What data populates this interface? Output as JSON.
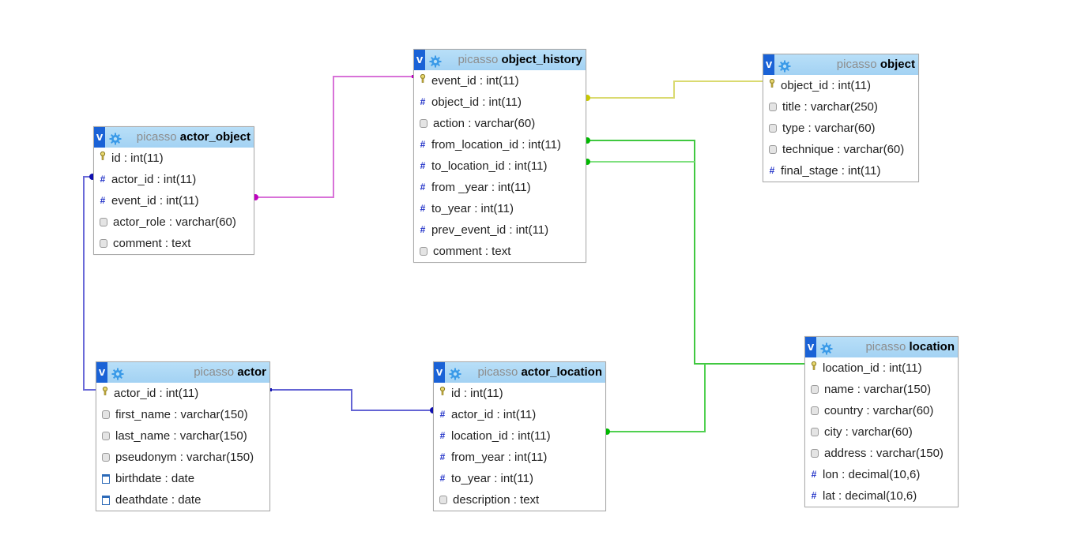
{
  "tables": {
    "actor_object": {
      "db": "picasso",
      "name": "actor_object",
      "columns": [
        {
          "icon": "key",
          "label": "id : int(11)"
        },
        {
          "icon": "num",
          "label": "actor_id : int(11)"
        },
        {
          "icon": "num",
          "label": "event_id : int(11)"
        },
        {
          "icon": "txt",
          "label": "actor_role : varchar(60)"
        },
        {
          "icon": "txt",
          "label": "comment : text"
        }
      ]
    },
    "object_history": {
      "db": "picasso",
      "name": "object_history",
      "columns": [
        {
          "icon": "key",
          "label": "event_id : int(11)"
        },
        {
          "icon": "num",
          "label": "object_id : int(11)"
        },
        {
          "icon": "txt",
          "label": "action : varchar(60)"
        },
        {
          "icon": "num",
          "label": "from_location_id : int(11)"
        },
        {
          "icon": "num",
          "label": "to_location_id : int(11)"
        },
        {
          "icon": "num",
          "label": "from _year : int(11)"
        },
        {
          "icon": "num",
          "label": "to_year : int(11)"
        },
        {
          "icon": "num",
          "label": "prev_event_id : int(11)"
        },
        {
          "icon": "txt",
          "label": "comment : text"
        }
      ]
    },
    "object": {
      "db": "picasso",
      "name": "object",
      "columns": [
        {
          "icon": "key",
          "label": "object_id : int(11)"
        },
        {
          "icon": "txt",
          "label": "title : varchar(250)"
        },
        {
          "icon": "txt",
          "label": "type : varchar(60)"
        },
        {
          "icon": "txt",
          "label": "technique : varchar(60)"
        },
        {
          "icon": "num",
          "label": "final_stage : int(11)"
        }
      ]
    },
    "actor": {
      "db": "picasso",
      "name": "actor",
      "columns": [
        {
          "icon": "key",
          "label": "actor_id : int(11)"
        },
        {
          "icon": "txt",
          "label": "first_name : varchar(150)"
        },
        {
          "icon": "txt",
          "label": "last_name : varchar(150)"
        },
        {
          "icon": "txt",
          "label": "pseudonym : varchar(150)"
        },
        {
          "icon": "date",
          "label": "birthdate : date"
        },
        {
          "icon": "date",
          "label": "deathdate : date"
        }
      ]
    },
    "actor_location": {
      "db": "picasso",
      "name": "actor_location",
      "columns": [
        {
          "icon": "key",
          "label": "id : int(11)"
        },
        {
          "icon": "num",
          "label": "actor_id : int(11)"
        },
        {
          "icon": "num",
          "label": "location_id : int(11)"
        },
        {
          "icon": "num",
          "label": "from_year : int(11)"
        },
        {
          "icon": "num",
          "label": "to_year : int(11)"
        },
        {
          "icon": "txt",
          "label": "description : text"
        }
      ]
    },
    "location": {
      "db": "picasso",
      "name": "location",
      "columns": [
        {
          "icon": "key",
          "label": "location_id : int(11)"
        },
        {
          "icon": "txt",
          "label": "name : varchar(150)"
        },
        {
          "icon": "txt",
          "label": "country : varchar(60)"
        },
        {
          "icon": "txt",
          "label": "city : varchar(60)"
        },
        {
          "icon": "txt",
          "label": "address : varchar(150)"
        },
        {
          "icon": "num",
          "label": "lon : decimal(10,6)"
        },
        {
          "icon": "num",
          "label": "lat : decimal(10,6)"
        }
      ]
    }
  },
  "relations": [
    {
      "from": "actor_object.event_id",
      "to": "object_history.event_id",
      "color": "#d060d0"
    },
    {
      "from": "object_history.object_id",
      "to": "object.object_id",
      "color": "#d8d860"
    },
    {
      "from": "object_history.from_location_id",
      "to": "location.location_id",
      "color": "#40d040"
    },
    {
      "from": "object_history.to_location_id",
      "to": "location.location_id",
      "color": "#70e070"
    },
    {
      "from": "actor_location.location_id",
      "to": "location.location_id",
      "color": "#50d850"
    },
    {
      "from": "actor_object.actor_id",
      "to": "actor.actor_id",
      "color": "#6868d8"
    },
    {
      "from": "actor_location.actor_id",
      "to": "actor.actor_id",
      "color": "#6060d0"
    }
  ],
  "icons": {
    "header_toggle": "v",
    "header_gear": "gear-icon",
    "key": "key-icon",
    "num": "hash-icon",
    "txt": "text-field-icon",
    "date": "calendar-icon"
  }
}
